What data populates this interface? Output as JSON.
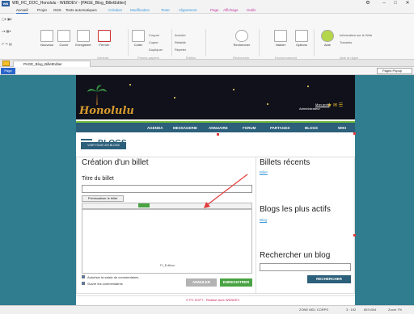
{
  "window": {
    "app_logo": "WB",
    "title": "WB_HC_DOC_Honolulu - WEBDEV - [PAGE_Blog_BilletEditer]"
  },
  "menubar": {
    "items": [
      "Accueil",
      "Projet",
      "GDS",
      "Tests automatiques",
      "Création",
      "Modification",
      "Texte",
      "Alignement",
      "Page",
      "Affichage",
      "Outils"
    ]
  },
  "ribbon": {
    "buttons": [
      "Nouveau",
      "Ouvrir",
      "Enregistrer",
      "Fermer",
      "Coller",
      "Rechercher",
      "Valider",
      "Options",
      "Aide"
    ],
    "small": [
      "Couper",
      "Copier",
      "Dupliquer",
      "Annuler",
      "Rétablir",
      "Répéter",
      "Information sur le Web",
      "Tutoriels"
    ],
    "groups": [
      "Général",
      "Presse-papiers",
      "Édition",
      "Rechercher",
      "Environnement",
      "Aide en ligne"
    ]
  },
  "doctab": {
    "label": "PAGE_Blog_BilletEditer"
  },
  "subbar": {
    "page_label": "Page",
    "pages_popup": "Pages Popup"
  },
  "site": {
    "logo": "Honolulu",
    "account": "Mon profil",
    "account2": "Administrateur",
    "nav": [
      "AGENDA",
      "MESSAGERIE",
      "ANNUAIRE",
      "FORUM",
      "PARTAGES",
      "BLOGS",
      "WIKI"
    ],
    "blogs_title": "BLOGS",
    "voir_tous": "VOIR TOUS LES BLOGS",
    "create_title": "Création d'un billet",
    "titre_label": "Titre du billet",
    "preview_btn": "Prévisualiser le billet",
    "editor_label": "FI_Editeur",
    "chk_comments": "Autoriser la saisie de commentaires",
    "chk_follow": "Suivre les commentaires",
    "cancel": "ANNULER",
    "save": "ENREGISTRER",
    "billets_recents": "Billets récents",
    "billets_link": "Billet",
    "blogs_actifs": "Blogs les plus actifs",
    "blogs_link": "Blog",
    "rechercher_title": "Rechercher un blog",
    "rechercher_btn": "RECHERCHER",
    "footer": "© PC SOFT - Réalisé avec WEBDEV"
  },
  "status": {
    "mode": "ZONE MDI, CORPS",
    "coords": "3 : 192",
    "size": "857x304",
    "zoom": "Zoom 7%"
  },
  "colors": {
    "canvas": "#2f7d8e",
    "nav": "#2b5f7a",
    "green": "#49a342"
  }
}
